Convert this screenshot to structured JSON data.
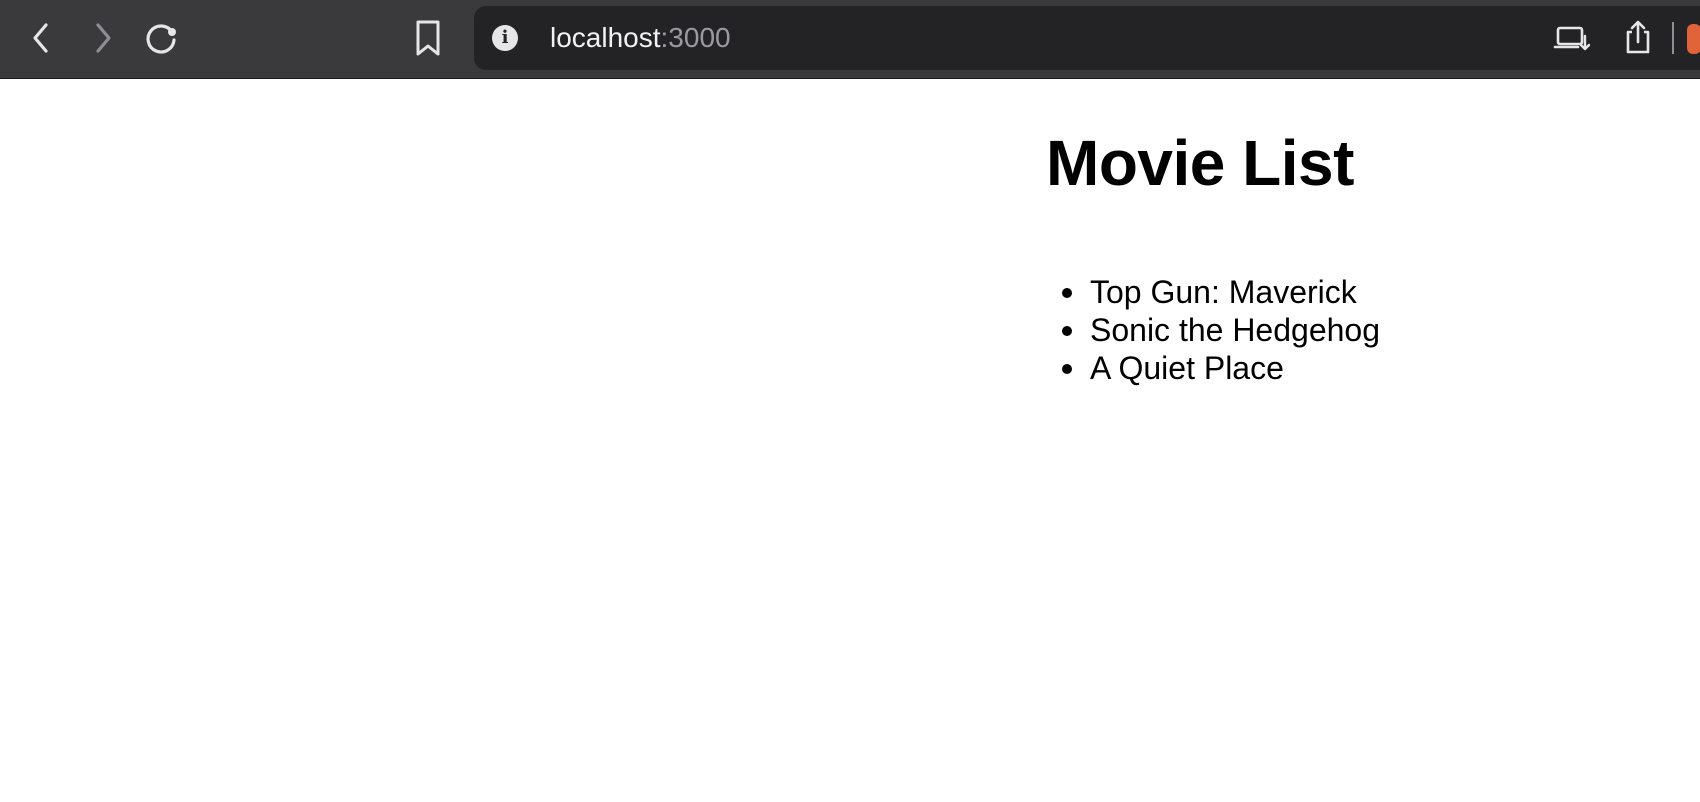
{
  "browser": {
    "url_host": "localhost",
    "url_port": ":3000",
    "icons": {
      "back": "chevron-left-icon",
      "forward": "chevron-right-icon",
      "reload": "reload-icon",
      "bookmark": "bookmark-icon",
      "site_info": "info-icon",
      "cast": "laptop-download-icon",
      "share": "share-icon"
    },
    "site_info_glyph": "i"
  },
  "page": {
    "title": "Movie List",
    "movies": [
      "Top Gun: Maverick",
      "Sonic the Hedgehog",
      "A Quiet Place"
    ]
  },
  "colors": {
    "toolbar_bg": "#3a3a3d",
    "address_bar_bg": "#232326",
    "page_bg": "#ffffff",
    "text": "#000000"
  }
}
